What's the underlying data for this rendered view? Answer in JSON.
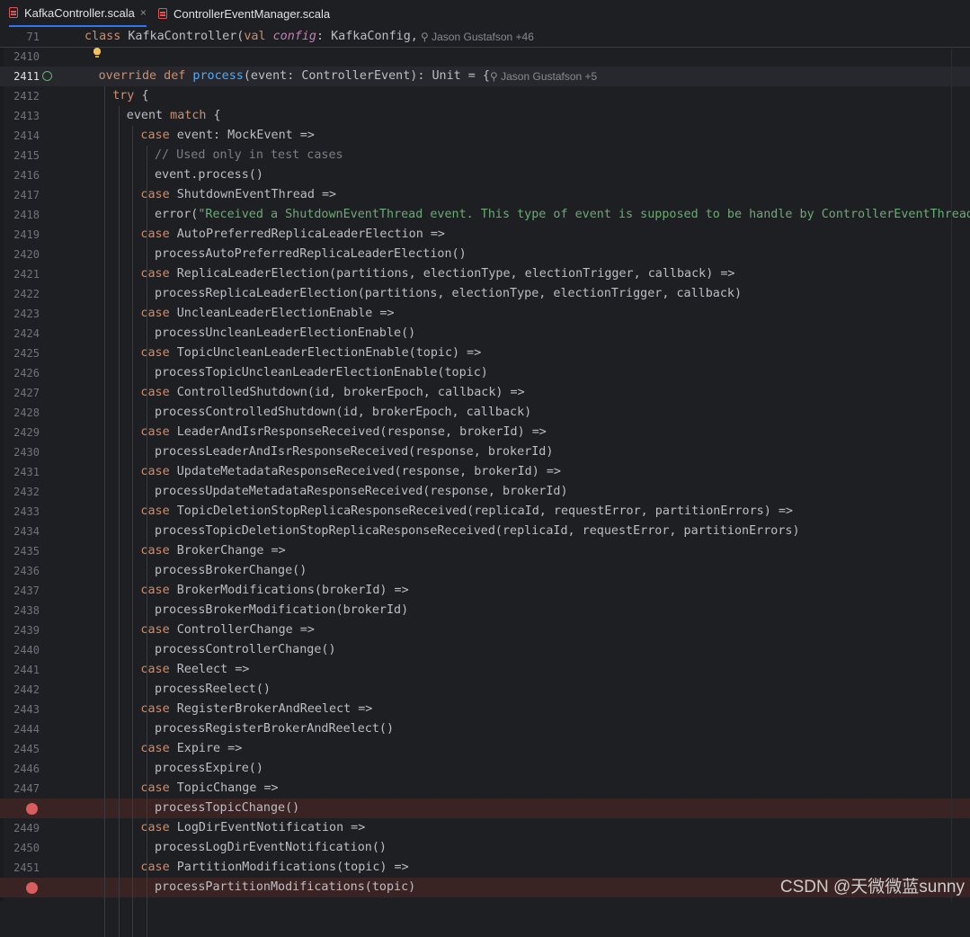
{
  "tabs": [
    {
      "label": "KafkaController.scala",
      "active": true,
      "close": "×"
    },
    {
      "label": "ControllerEventManager.scala",
      "active": false
    }
  ],
  "sticky": {
    "line": "71",
    "code": [
      [
        "kw",
        "class "
      ],
      [
        "p",
        "KafkaController("
      ],
      [
        "kw",
        "val "
      ],
      [
        "param",
        "config"
      ],
      [
        "p",
        ": KafkaConfig,"
      ]
    ],
    "hint": "Jason Gustafson +46"
  },
  "colors": {
    "background": "#1e1f22",
    "keyword": "#cf8e6d",
    "function": "#56a8f5",
    "string": "#6aab73",
    "comment": "#7a7e85",
    "parameter": "#c77dbb",
    "breakpoint": "#db5c5c",
    "breakpoint_line": "#3a2323"
  },
  "lines": [
    {
      "n": "2410",
      "indent": 0,
      "code": []
    },
    {
      "n": "2411",
      "indent": 1,
      "icon": "implements-icon",
      "current": true,
      "hint": "Jason Gustafson +5",
      "code": [
        [
          "kw",
          "override def "
        ],
        [
          "fn",
          "process"
        ],
        [
          "p",
          "(event: ControllerEvent): Unit = {"
        ]
      ]
    },
    {
      "n": "2412",
      "indent": 2,
      "code": [
        [
          "kw",
          "try "
        ],
        [
          "p",
          "{"
        ]
      ]
    },
    {
      "n": "2413",
      "indent": 3,
      "code": [
        [
          "p",
          "event "
        ],
        [
          "kw",
          "match "
        ],
        [
          "p",
          "{"
        ]
      ]
    },
    {
      "n": "2414",
      "indent": 4,
      "code": [
        [
          "kw",
          "case "
        ],
        [
          "p",
          "event: MockEvent =>"
        ]
      ]
    },
    {
      "n": "2415",
      "indent": 5,
      "code": [
        [
          "cmt",
          "// Used only in test cases"
        ]
      ]
    },
    {
      "n": "2416",
      "indent": 5,
      "code": [
        [
          "p",
          "event.process()"
        ]
      ]
    },
    {
      "n": "2417",
      "indent": 4,
      "code": [
        [
          "kw",
          "case "
        ],
        [
          "p",
          "ShutdownEventThread =>"
        ]
      ]
    },
    {
      "n": "2418",
      "indent": 5,
      "code": [
        [
          "p",
          "error("
        ],
        [
          "str",
          "\"Received a ShutdownEventThread event. This type of event is supposed to be handle by ControllerEventThread\""
        ],
        [
          "p",
          ")"
        ]
      ]
    },
    {
      "n": "2419",
      "indent": 4,
      "code": [
        [
          "kw",
          "case "
        ],
        [
          "p",
          "AutoPreferredReplicaLeaderElection =>"
        ]
      ]
    },
    {
      "n": "2420",
      "indent": 5,
      "code": [
        [
          "p",
          "processAutoPreferredReplicaLeaderElection()"
        ]
      ]
    },
    {
      "n": "2421",
      "indent": 4,
      "code": [
        [
          "kw",
          "case "
        ],
        [
          "p",
          "ReplicaLeaderElection(partitions, electionType, electionTrigger, callback) =>"
        ]
      ]
    },
    {
      "n": "2422",
      "indent": 5,
      "code": [
        [
          "p",
          "processReplicaLeaderElection(partitions, electionType, electionTrigger, callback)"
        ]
      ]
    },
    {
      "n": "2423",
      "indent": 4,
      "code": [
        [
          "kw",
          "case "
        ],
        [
          "p",
          "UncleanLeaderElectionEnable =>"
        ]
      ]
    },
    {
      "n": "2424",
      "indent": 5,
      "code": [
        [
          "p",
          "processUncleanLeaderElectionEnable()"
        ]
      ]
    },
    {
      "n": "2425",
      "indent": 4,
      "code": [
        [
          "kw",
          "case "
        ],
        [
          "p",
          "TopicUncleanLeaderElectionEnable(topic) =>"
        ]
      ]
    },
    {
      "n": "2426",
      "indent": 5,
      "code": [
        [
          "p",
          "processTopicUncleanLeaderElectionEnable(topic)"
        ]
      ]
    },
    {
      "n": "2427",
      "indent": 4,
      "code": [
        [
          "kw",
          "case "
        ],
        [
          "p",
          "ControlledShutdown(id, brokerEpoch, callback) =>"
        ]
      ]
    },
    {
      "n": "2428",
      "indent": 5,
      "code": [
        [
          "p",
          "processControlledShutdown(id, brokerEpoch, callback)"
        ]
      ]
    },
    {
      "n": "2429",
      "indent": 4,
      "code": [
        [
          "kw",
          "case "
        ],
        [
          "p",
          "LeaderAndIsrResponseReceived(response, brokerId) =>"
        ]
      ]
    },
    {
      "n": "2430",
      "indent": 5,
      "code": [
        [
          "p",
          "processLeaderAndIsrResponseReceived(response, brokerId)"
        ]
      ]
    },
    {
      "n": "2431",
      "indent": 4,
      "code": [
        [
          "kw",
          "case "
        ],
        [
          "p",
          "UpdateMetadataResponseReceived(response, brokerId) =>"
        ]
      ]
    },
    {
      "n": "2432",
      "indent": 5,
      "code": [
        [
          "p",
          "processUpdateMetadataResponseReceived(response, brokerId)"
        ]
      ]
    },
    {
      "n": "2433",
      "indent": 4,
      "code": [
        [
          "kw",
          "case "
        ],
        [
          "p",
          "TopicDeletionStopReplicaResponseReceived(replicaId, requestError, partitionErrors) =>"
        ]
      ]
    },
    {
      "n": "2434",
      "indent": 5,
      "code": [
        [
          "p",
          "processTopicDeletionStopReplicaResponseReceived(replicaId, requestError, partitionErrors)"
        ]
      ]
    },
    {
      "n": "2435",
      "indent": 4,
      "code": [
        [
          "kw",
          "case "
        ],
        [
          "p",
          "BrokerChange =>"
        ]
      ]
    },
    {
      "n": "2436",
      "indent": 5,
      "code": [
        [
          "p",
          "processBrokerChange()"
        ]
      ]
    },
    {
      "n": "2437",
      "indent": 4,
      "code": [
        [
          "kw",
          "case "
        ],
        [
          "p",
          "BrokerModifications(brokerId) =>"
        ]
      ]
    },
    {
      "n": "2438",
      "indent": 5,
      "code": [
        [
          "p",
          "processBrokerModification(brokerId)"
        ]
      ]
    },
    {
      "n": "2439",
      "indent": 4,
      "code": [
        [
          "kw",
          "case "
        ],
        [
          "p",
          "ControllerChange =>"
        ]
      ]
    },
    {
      "n": "2440",
      "indent": 5,
      "code": [
        [
          "p",
          "processControllerChange()"
        ]
      ]
    },
    {
      "n": "2441",
      "indent": 4,
      "code": [
        [
          "kw",
          "case "
        ],
        [
          "p",
          "Reelect =>"
        ]
      ]
    },
    {
      "n": "2442",
      "indent": 5,
      "code": [
        [
          "p",
          "processReelect()"
        ]
      ]
    },
    {
      "n": "2443",
      "indent": 4,
      "code": [
        [
          "kw",
          "case "
        ],
        [
          "p",
          "RegisterBrokerAndReelect =>"
        ]
      ]
    },
    {
      "n": "2444",
      "indent": 5,
      "code": [
        [
          "p",
          "processRegisterBrokerAndReelect()"
        ]
      ]
    },
    {
      "n": "2445",
      "indent": 4,
      "code": [
        [
          "kw",
          "case "
        ],
        [
          "p",
          "Expire =>"
        ]
      ]
    },
    {
      "n": "2446",
      "indent": 5,
      "code": [
        [
          "p",
          "processExpire()"
        ]
      ]
    },
    {
      "n": "2447",
      "indent": 4,
      "code": [
        [
          "kw",
          "case "
        ],
        [
          "p",
          "TopicChange =>"
        ]
      ]
    },
    {
      "n": "",
      "indent": 5,
      "breakpoint": true,
      "code": [
        [
          "p",
          "processTopicChange()"
        ]
      ]
    },
    {
      "n": "2449",
      "indent": 4,
      "code": [
        [
          "kw",
          "case "
        ],
        [
          "p",
          "LogDirEventNotification =>"
        ]
      ]
    },
    {
      "n": "2450",
      "indent": 5,
      "code": [
        [
          "p",
          "processLogDirEventNotification()"
        ]
      ]
    },
    {
      "n": "2451",
      "indent": 4,
      "code": [
        [
          "kw",
          "case "
        ],
        [
          "p",
          "PartitionModifications(topic) =>"
        ]
      ]
    },
    {
      "n": "",
      "indent": 5,
      "breakpoint": true,
      "code": [
        [
          "p",
          "processPartitionModifications(topic)"
        ]
      ]
    }
  ],
  "watermark": "CSDN @天微微蓝sunny"
}
